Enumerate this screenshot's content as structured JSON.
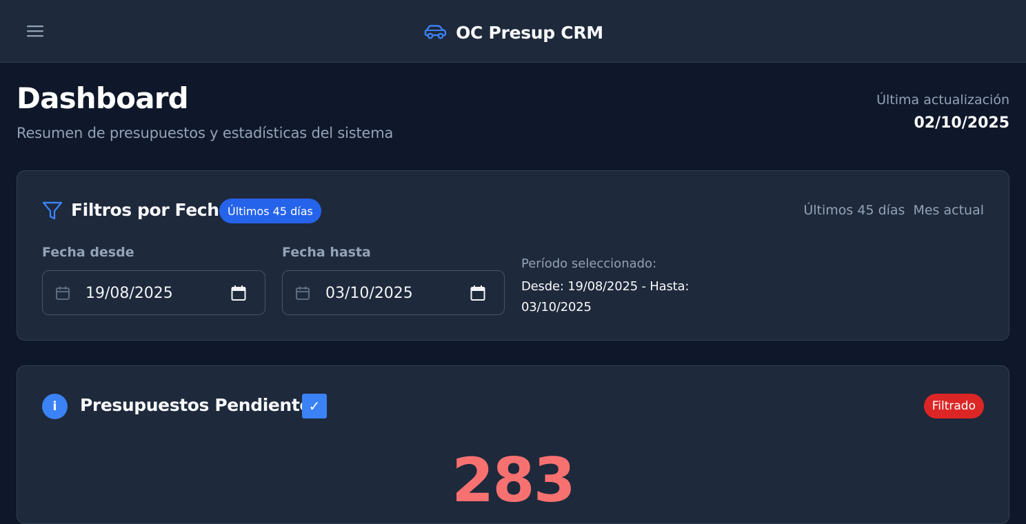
{
  "header": {
    "title": "OC Presup CRM",
    "icons": {
      "menu": "hamburger-icon",
      "brand": "car-icon"
    }
  },
  "page": {
    "title": "Dashboard",
    "subtitle": "Resumen de presupuestos y estadísticas del sistema",
    "last_update_label": "Última actualización",
    "last_update_date": "02/10/2025"
  },
  "filters": {
    "title": "Filtros por Fecha",
    "active_chip": "Últimos 45 días",
    "quick_links": [
      "Últimos 45 días",
      "Mes actual"
    ],
    "from": {
      "label": "Fecha desde",
      "value": "19/08/2025"
    },
    "to": {
      "label": "Fecha hasta",
      "value": "03/10/2025"
    },
    "period_label": "Período seleccionado:",
    "period_value": "Desde: 19/08/2025 - Hasta: 03/10/2025"
  },
  "pending": {
    "title": "Presupuestos Pendientes",
    "checkbox_mark": "✓",
    "checked": true,
    "badge": "Filtrado",
    "count": "283"
  },
  "colors": {
    "background": "#0f172a",
    "surface": "#1e293b",
    "accent": "#3b82f6",
    "chip_blue": "#2563eb",
    "chip_red": "#dc2626",
    "count": "#f87171"
  }
}
